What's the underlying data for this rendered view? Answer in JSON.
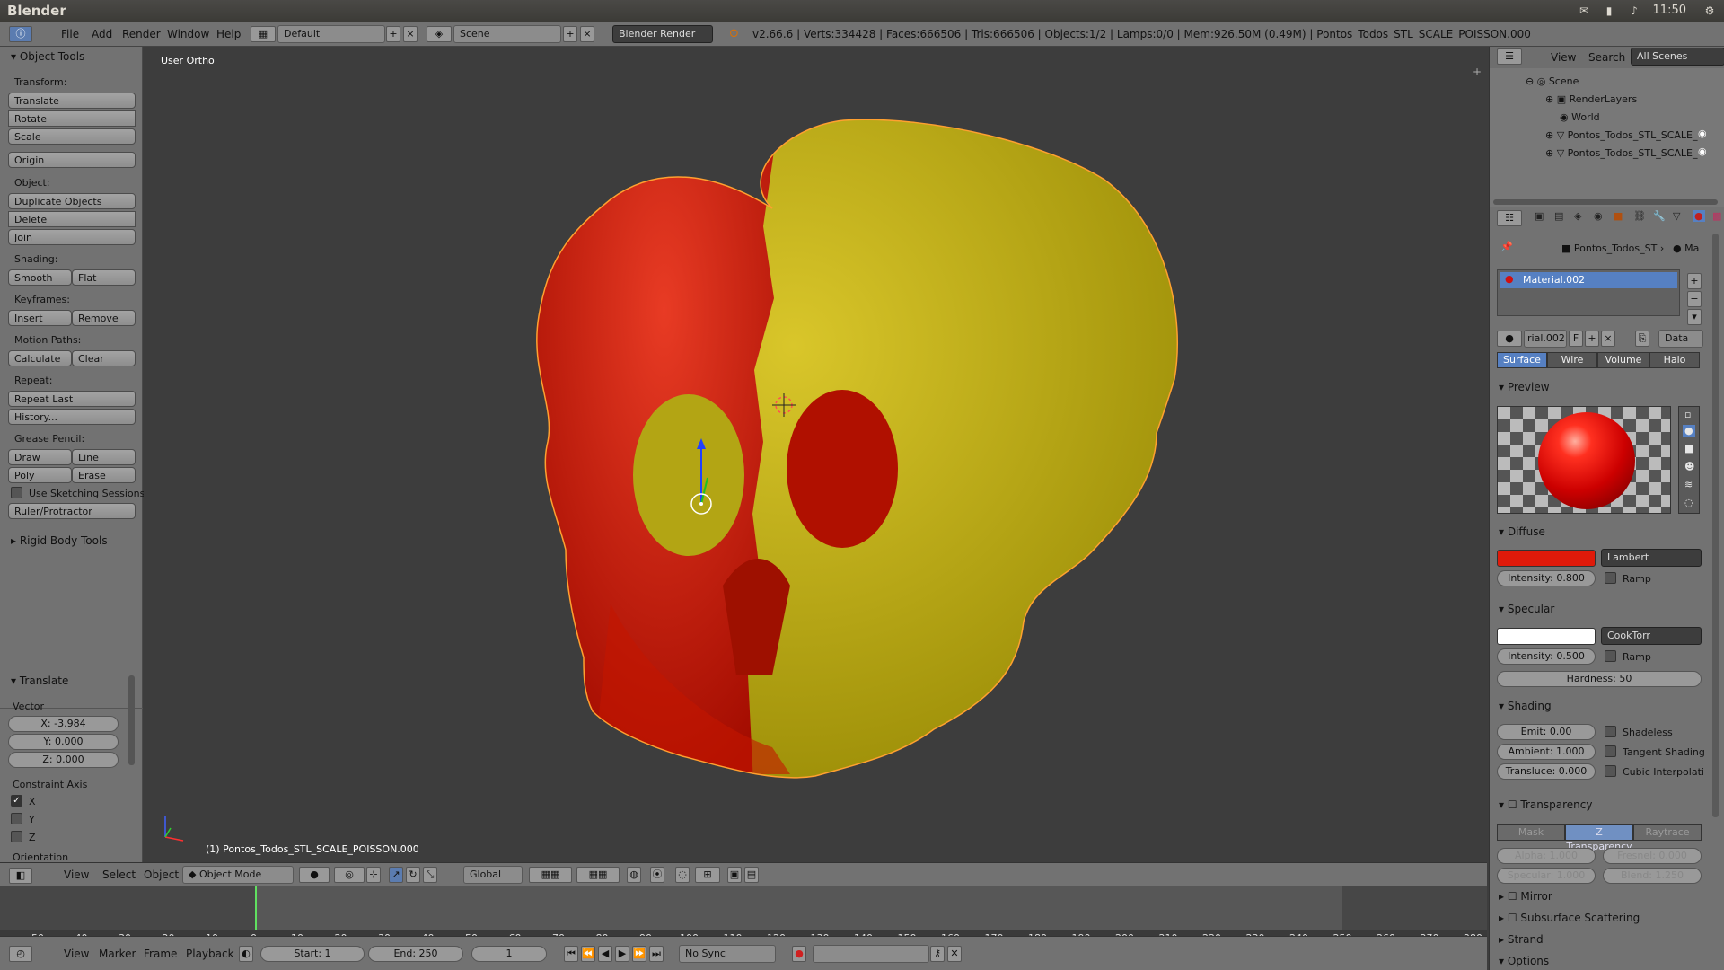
{
  "os": {
    "title": "Blender",
    "clock": "11:50"
  },
  "menus": [
    "File",
    "Add",
    "Render",
    "Window",
    "Help"
  ],
  "layout": "Default",
  "scene": "Scene",
  "engine": "Blender Render",
  "info": "v2.66.6 | Verts:334428 | Faces:666506 | Tris:666506 | Objects:1/2 | Lamps:0/0 | Mem:926.50M (0.49M) | Pontos_Todos_STL_SCALE_POISSON.000",
  "tools": {
    "title": "Object Tools",
    "transform_label": "Transform:",
    "translate": "Translate",
    "rotate": "Rotate",
    "scale": "Scale",
    "origin": "Origin",
    "object_label": "Object:",
    "duplicate": "Duplicate Objects",
    "delete": "Delete",
    "join": "Join",
    "shading_label": "Shading:",
    "smooth": "Smooth",
    "flat": "Flat",
    "keyframes_label": "Keyframes:",
    "insert": "Insert",
    "remove": "Remove",
    "motion_label": "Motion Paths:",
    "calculate": "Calculate",
    "clear": "Clear",
    "repeat_label": "Repeat:",
    "repeat_last": "Repeat Last",
    "history": "History...",
    "grease_label": "Grease Pencil:",
    "draw": "Draw",
    "line": "Line",
    "poly": "Poly",
    "erase": "Erase",
    "sketch": "Use Sketching Sessions",
    "ruler": "Ruler/Protractor",
    "rigid": "Rigid Body Tools"
  },
  "op": {
    "title": "Translate",
    "vector": "Vector",
    "x": "X: -3.984",
    "y": "Y: 0.000",
    "z": "Z: 0.000",
    "constraint": "Constraint Axis",
    "cx": "X",
    "cy": "Y",
    "cz": "Z",
    "orientation": "Orientation"
  },
  "viewport": {
    "view_label": "User Ortho",
    "object_label": "(1) Pontos_Todos_STL_SCALE_POISSON.000"
  },
  "vheader": {
    "view": "View",
    "select": "Select",
    "object": "Object",
    "mode": "Object Mode",
    "orientation": "Global"
  },
  "timeline": {
    "ticks": [
      "-50",
      "-40",
      "-30",
      "-20",
      "-10",
      "0",
      "10",
      "20",
      "30",
      "40",
      "50",
      "60",
      "70",
      "80",
      "90",
      "100",
      "110",
      "120",
      "130",
      "140",
      "150",
      "160",
      "170",
      "180",
      "190",
      "200",
      "210",
      "220",
      "230",
      "240",
      "250",
      "260",
      "270",
      "280"
    ],
    "current_frame": "0"
  },
  "tlheader": {
    "view": "View",
    "marker": "Marker",
    "frame": "Frame",
    "playback": "Playback",
    "start": "Start: 1",
    "end": "End: 250",
    "frame_num": "1",
    "sync": "No Sync"
  },
  "outliner": {
    "view": "View",
    "search": "Search",
    "filter": "All Scenes",
    "items": [
      "Scene",
      "RenderLayers",
      "World",
      "Pontos_Todos_STL_SCALE_PC",
      "Pontos_Todos_STL_SCALE_PC"
    ]
  },
  "props": {
    "breadcrumb_obj": "Pontos_Todos_ST",
    "breadcrumb_mat": "Ma",
    "material": "Material.002",
    "mat_short": "rial.002",
    "f": "F",
    "data": "Data",
    "tabs": [
      "Surface",
      "Wire",
      "Volume",
      "Halo"
    ],
    "preview": "Preview",
    "diffuse": "Diffuse",
    "diffuse_shader": "Lambert",
    "diffuse_intensity": "Intensity: 0.800",
    "ramp": "Ramp",
    "specular": "Specular",
    "spec_shader": "CookTorr",
    "spec_intensity": "Intensity: 0.500",
    "hardness": "Hardness: 50",
    "shading": "Shading",
    "emit": "Emit: 0.00",
    "ambient": "Ambient: 1.000",
    "translucency": "Transluce: 0.000",
    "shadeless": "Shadeless",
    "tangent": "Tangent Shading",
    "cubic": "Cubic Interpolati",
    "transparency": "Transparency",
    "mask": "Mask",
    "ztrans": "Z Transparency",
    "raytrace": "Raytrace",
    "alpha": "Alpha: 1.000",
    "fresnel": "Fresnel: 0.000",
    "spec_t": "Specular: 1.000",
    "blend": "Blend: 1.250",
    "mirror": "Mirror",
    "sss": "Subsurface Scattering",
    "strand": "Strand",
    "options": "Options"
  },
  "colors": {
    "red": "#cc1100",
    "yellow": "#c8b400",
    "accent": "#5680c2"
  }
}
